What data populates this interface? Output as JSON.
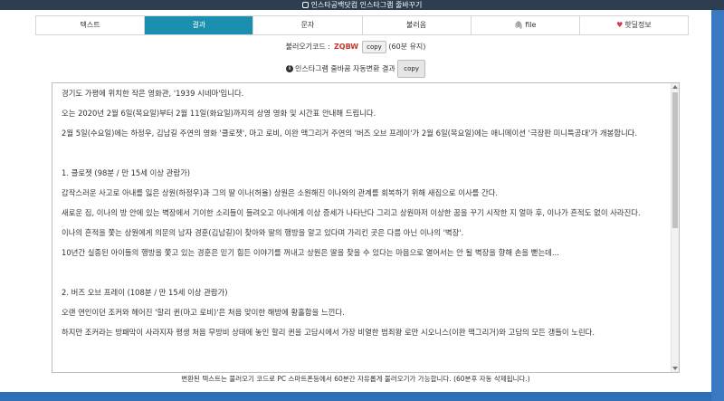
{
  "window": {
    "title": "인스타공백닷컴 인스타그램 줄바꾸기"
  },
  "tabs": [
    {
      "label": "텍스트",
      "active": false
    },
    {
      "label": "결과",
      "active": true
    },
    {
      "label": "문자",
      "active": false
    },
    {
      "label": "불러옴",
      "active": false
    },
    {
      "label": "file",
      "active": false,
      "icon": "paperclip-icon"
    },
    {
      "label": "핫딜정보",
      "active": false,
      "icon": "heart-icon"
    }
  ],
  "load_code": {
    "label": "불러오기코드 :",
    "code": "ZQBW",
    "copy_label": "copy",
    "note": "(60분 유지)"
  },
  "result": {
    "info_label": "인스타그램 줄바꿈 자동변환 결과",
    "copy_label": "copy"
  },
  "content": {
    "paragraphs": [
      "경기도 가평에 위치한 작은 영화관, '1939 시네마'입니다.",
      "오는 2020년 2월 6일(목요일)부터 2월 11일(화요일)까지의 상영 영화 및 시간표 안내해 드립니다.",
      "2월 5일(수요일)에는 하정우, 김남길 주연의 영화 '클로젯', 마고 로비, 이완 맥그리거 주연의 '버즈 오브 프레이'가 2월 6일(목요일)에는 애니메이션 '극장판 미니특공대'가 개봉합니다.",
      "",
      "1. 클로젯 (98분 / 만 15세 이상 관람가)",
      "갑작스러운 사고로 아내를 잃은 상원(하정우)과 그의 딸 이나(허율) 상원은 소원해진 이나와의 관계를 회복하기 위해 새집으로 이사를 간다.",
      "새로운 집, 이나의 방 안에 있는 벽장에서 기이한 소리들이 들려오고 이나에게 이상 증세가 나타난다 그리고 상원마저 이상한 꿈을 꾸기 시작한 지 얼마 후, 이나가 흔적도 없이 사라진다.",
      "이나의 흔적을 쫓는 상원에게 의문의 남자 경훈(김남길)이 찾아와 딸의 행방을 알고 있다며 가리킨 곳은 다름 아닌 이나의 '벽장'.",
      "10년간 실종된 아이들의 행방을 쫓고 있는 경훈은 믿기 힘든 이야기를 꺼내고 상원은 딸을 찾을 수 있다는 마음으로 열어서는 안 될 벽장을 향해 손을 뻗는데...",
      "",
      "2. 버즈 오브 프레이 (108분 / 만 15세 이상 관람가)",
      "오랜 연인이던 조커와 헤어진 '할리 퀸(마고 로비)'은 처음 맞이한 해방에 황홀함을 느낀다.",
      "하지만 조커라는 방패막이 사라지자 평생 처음 무방비 상태에 놓인 할리 퀸을 고담시에서 가장 비열한 범죄왕 로만 시오니스(이완 맥그리거)와 고담의 모든 갱들이 노린다."
    ]
  },
  "footnote": "변환된 텍스트는 불러오기 코드로 PC 스마트폰등에서 60분간 자유롭게 불러오기가 가능합니다. (60분후 자동 삭제됩니다.)",
  "colors": {
    "active_tab": "#1a8fb0",
    "code": "#c0392b",
    "topbar": "#2c3e50"
  }
}
